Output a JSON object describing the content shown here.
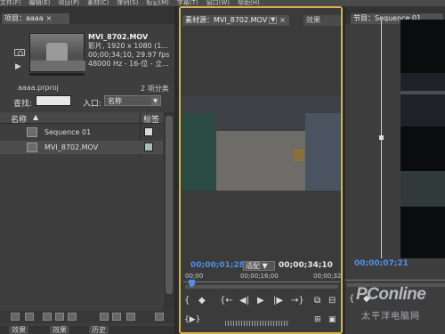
{
  "menu": [
    "文件(F)",
    "编辑(E)",
    "项目(P)",
    "素材(C)",
    "序列(S)",
    "标记(M)",
    "字幕(T)",
    "窗口(W)",
    "帮助(H)"
  ],
  "project_panel": {
    "tab_label": "项目：aaaa",
    "clip": {
      "filename": "MVI_8702.MOV",
      "line1": "影片, 1920 x 1080 (1...",
      "line2": "00;00;34;10, 29.97 fps",
      "line3": "48000 Hz - 16-位 - 立..."
    },
    "project_file": "aaaa.prproj",
    "item_count": "2 项分类",
    "search_label": "查找:",
    "in_label": "入口:",
    "in_value": "名称",
    "columns": {
      "name": "名称",
      "label": "标签"
    },
    "items": [
      {
        "name": "Sequence 01",
        "swatch": "#d8d8d8"
      },
      {
        "name": "MVI_8702.MOV",
        "swatch": "#9fc2b8"
      }
    ],
    "lower_tabs": [
      "效果",
      "效果",
      "历史"
    ]
  },
  "source_monitor": {
    "tab_label": "素材源：MVI_8702.MOV",
    "tab2": "效果",
    "timecode_current": "00;00;01;28",
    "fit": "适配",
    "timecode_duration": "00;00;34;10",
    "ruler_ticks": [
      "00;00",
      "00;00;16;00",
      "00;00;32"
    ]
  },
  "program_monitor": {
    "tab_label": "节目：Sequence 01",
    "timecode": "00;00;07;21"
  },
  "watermark": {
    "brand": "PConline",
    "tagline": "太平洋电脑网"
  }
}
